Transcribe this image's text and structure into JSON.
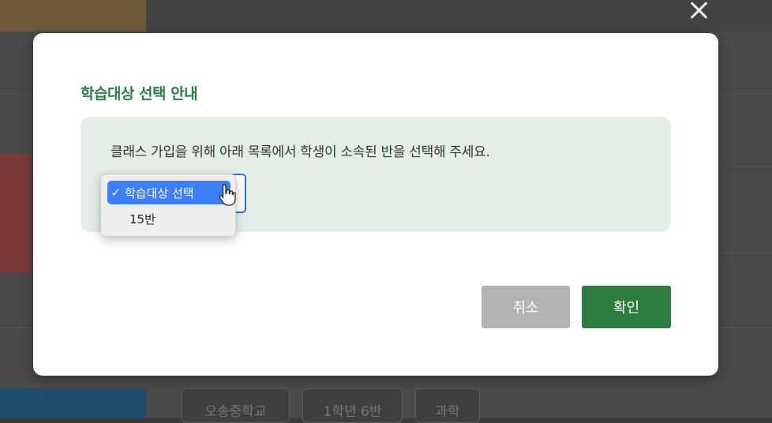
{
  "background": {
    "chips": [
      "오송중학교",
      "1학년 6반",
      "과학"
    ]
  },
  "modal": {
    "title": "학습대상 선택 안내",
    "info_text": "클래스 가입을 위해 아래 목록에서 학생이 소속된 반을 선택해 주세요.",
    "select": {
      "options": [
        {
          "label": "학습대상 선택",
          "selected": true
        },
        {
          "label": "15반",
          "selected": false
        }
      ],
      "check_symbol": "✓"
    },
    "buttons": {
      "cancel_label": "취소",
      "ok_label": "확인"
    }
  },
  "colors": {
    "title_green": "#2f7d45",
    "info_bg": "#e3efe6",
    "ok_button": "#2e7d40",
    "cancel_button": "#b3b3b3",
    "option_highlight": "#3e7ef7"
  }
}
